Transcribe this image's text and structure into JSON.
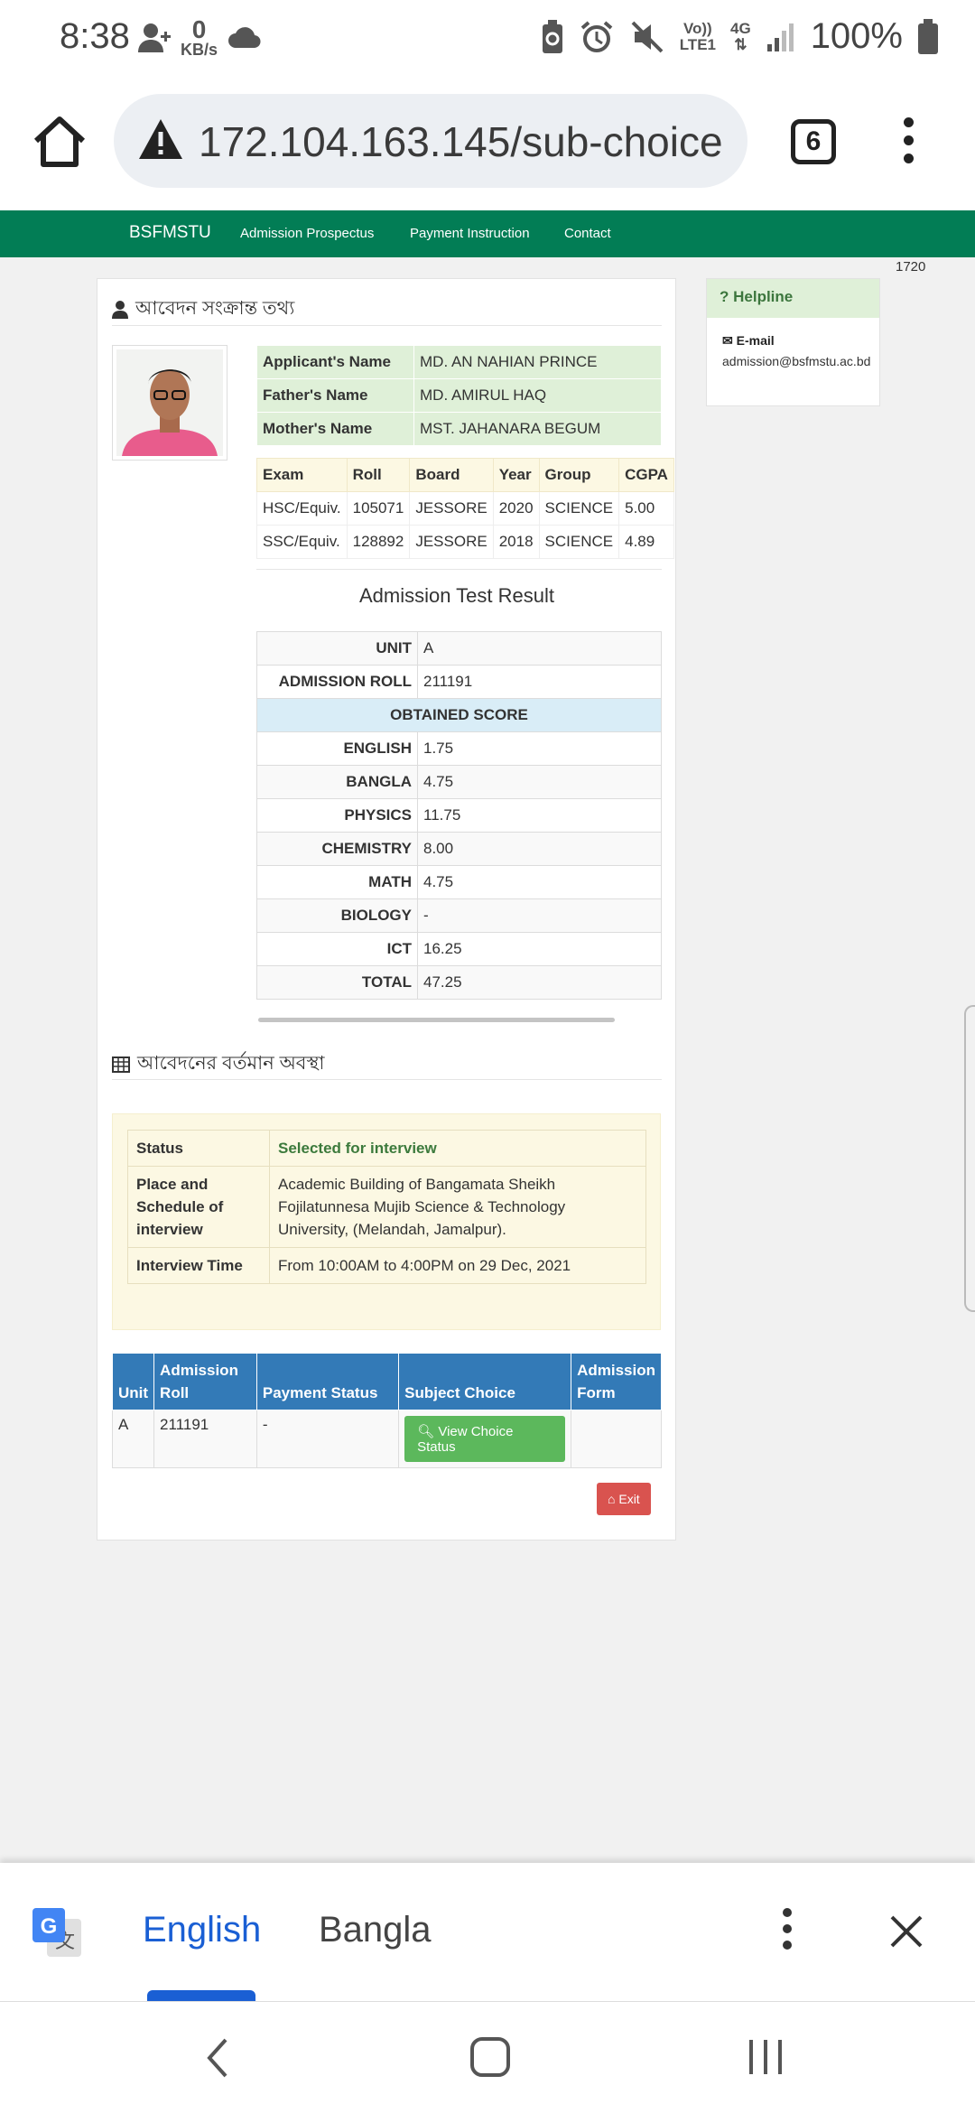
{
  "status_bar": {
    "time": "8:38",
    "data_rate_value": "0",
    "data_rate_unit": "KB/s",
    "network_top": "Vo))",
    "network_bottom": "LTE1",
    "network_gen": "4G",
    "battery": "100%"
  },
  "browser": {
    "url": "172.104.163.145/sub-choice",
    "tab_count": "6"
  },
  "navbar": {
    "brand": "BSFMSTU",
    "links": [
      "Admission Prospectus",
      "Payment Instruction",
      "Contact"
    ]
  },
  "counter": "1720",
  "applicant_section": {
    "heading": "আবেদন সংক্রান্ত তথ্য",
    "info": [
      {
        "label": "Applicant's Name",
        "value": "MD. AN NAHIAN PRINCE"
      },
      {
        "label": "Father's Name",
        "value": "MD. AMIRUL HAQ"
      },
      {
        "label": "Mother's Name",
        "value": "MST. JAHANARA BEGUM"
      }
    ],
    "exam_headers": [
      "Exam",
      "Roll",
      "Board",
      "Year",
      "Group",
      "CGPA"
    ],
    "exams": [
      [
        "HSC/Equiv.",
        "105071",
        "JESSORE",
        "2020",
        "SCIENCE",
        "5.00"
      ],
      [
        "SSC/Equiv.",
        "128892",
        "JESSORE",
        "2018",
        "SCIENCE",
        "4.89"
      ]
    ]
  },
  "result": {
    "title": "Admission Test Result",
    "unit_label": "UNIT",
    "unit": "A",
    "roll_label": "ADMISSION ROLL",
    "roll": "211191",
    "obtained_label": "OBTAINED SCORE",
    "scores": [
      {
        "subject": "ENGLISH",
        "score": "1.75"
      },
      {
        "subject": "BANGLA",
        "score": "4.75"
      },
      {
        "subject": "PHYSICS",
        "score": "11.75"
      },
      {
        "subject": "CHEMISTRY",
        "score": "8.00"
      },
      {
        "subject": "MATH",
        "score": "4.75"
      },
      {
        "subject": "BIOLOGY",
        "score": "-"
      },
      {
        "subject": "ICT",
        "score": "16.25"
      },
      {
        "subject": "TOTAL",
        "score": "47.25"
      }
    ]
  },
  "current_status": {
    "heading": "আবেদনের বর্তমান অবস্থা",
    "status_label": "Status",
    "status_value": "Selected for interview",
    "place_label": "Place and Schedule of interview",
    "place_value": "Academic Building of Bangamata Sheikh Fojilatunnesa Mujib Science & Technology University, (Melandah, Jamalpur).",
    "time_label": "Interview Time",
    "time_value": "From 10:00AM to 4:00PM on 29 Dec, 2021"
  },
  "application_table": {
    "headers": [
      "Unit",
      "Admission Roll",
      "Payment Status",
      "Subject Choice",
      "Admission Form"
    ],
    "row": {
      "unit": "A",
      "roll": "211191",
      "payment": "-",
      "choice_button": "View Choice Status",
      "form": ""
    }
  },
  "exit_button": "Exit",
  "helpline": {
    "title": "Helpline",
    "email_label": "E-mail",
    "email": "admission@bsfmstu.ac.bd"
  },
  "translate_bar": {
    "lang_from": "English",
    "lang_to": "Bangla"
  },
  "colors": {
    "navbar": "#027d55",
    "table_header_blue": "#337ab7",
    "button_green": "#5cb85c",
    "button_red": "#d9534f",
    "translate_accent": "#1a5fd4"
  }
}
